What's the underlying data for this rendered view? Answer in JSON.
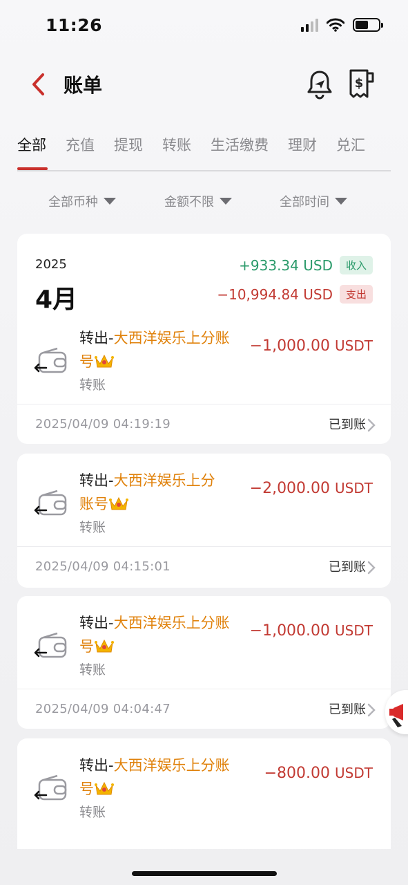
{
  "status_bar": {
    "time": "11:26"
  },
  "header": {
    "title": "账单"
  },
  "tabs": [
    {
      "label": "全部",
      "active": true
    },
    {
      "label": "充值"
    },
    {
      "label": "提现"
    },
    {
      "label": "转账"
    },
    {
      "label": "生活缴费"
    },
    {
      "label": "理财"
    },
    {
      "label": "兑汇"
    }
  ],
  "filters": {
    "currency": "全部币种",
    "amount": "金额不限",
    "time": "全部时间"
  },
  "summary": {
    "year": "2025",
    "month": "4月",
    "income": "+933.34 USD",
    "income_label": "收入",
    "expense": "−10,994.84 USD",
    "expense_label": "支出"
  },
  "transactions": [
    {
      "prefix": "转出-",
      "merchant_line1": "大西洋娱乐上分账",
      "merchant_line2": "号",
      "type": "转账",
      "amount": "−1,000.00",
      "currency": "USDT",
      "time": "2025/04/09   04:19:19",
      "status": "已到账"
    },
    {
      "prefix": "转出-",
      "merchant_line1": "大西洋娱乐上分",
      "merchant_line2": "账号",
      "type": "转账",
      "amount": "−2,000.00",
      "currency": "USDT",
      "time": "2025/04/09   04:15:01",
      "status": "已到账"
    },
    {
      "prefix": "转出-",
      "merchant_line1": "大西洋娱乐上分账",
      "merchant_line2": "号",
      "type": "转账",
      "amount": "−1,000.00",
      "currency": "USDT",
      "time": "2025/04/09   04:04:47",
      "status": "已到账"
    },
    {
      "prefix": "转出-",
      "merchant_line1": "大西洋娱乐上分账",
      "merchant_line2": "号",
      "type": "转账",
      "amount": "−800.00",
      "currency": "USDT",
      "time": "",
      "status": ""
    }
  ],
  "colors": {
    "accent": "#c9302c",
    "income": "#2a9a6a",
    "expense": "#c23a33",
    "merchant": "#e0820c"
  },
  "icons": [
    "back-arrow-icon",
    "bell-icon",
    "bill-icon",
    "wallet-out-icon",
    "crown-icon",
    "chevron-right-icon",
    "caret-down-icon"
  ]
}
